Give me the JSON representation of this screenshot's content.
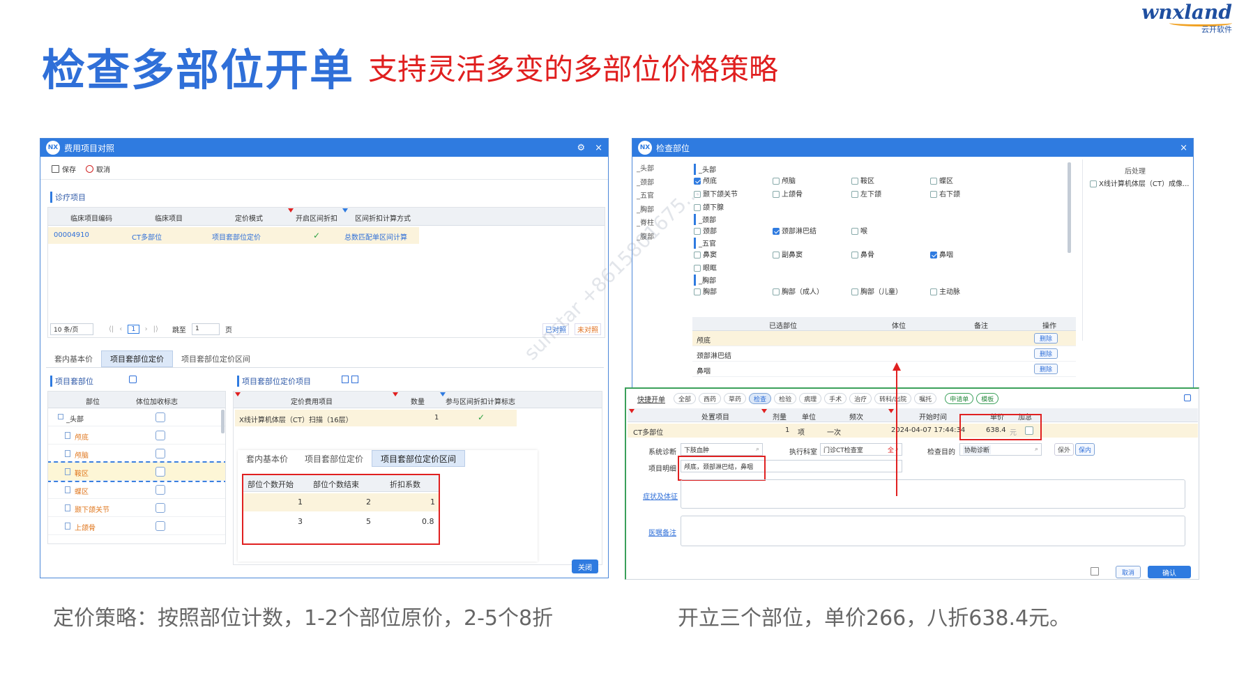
{
  "slide": {
    "title": "检查多部位开单",
    "subtitle": "支持灵活多变的多部位价格策略",
    "logo_text": "wnxland",
    "logo_sub": "云开软件",
    "caption_left": "定价策略：按照部位计数，1-2个部位原价，2-5个8折",
    "caption_right": "开立三个部位，单价266，八折638.4元。",
    "watermark": "sunstar +8615801675..."
  },
  "left": {
    "title": "费用项目对照",
    "gear": "⚙",
    "close": "×",
    "toolbar": {
      "save": "保存",
      "cancel": "取消"
    },
    "section": "诊疗项目",
    "cols": [
      "临床项目编码",
      "临床项目",
      "定价模式",
      "开启区间折扣",
      "区间折扣计算方式"
    ],
    "row": {
      "code": "00004910",
      "item": "CT多部位",
      "mode": "项目套部位定价",
      "flag": "✓",
      "calc": "总数匹配单区间计算"
    },
    "pager": {
      "size": "10 条/页",
      "first": "⟨|",
      "prev": "‹",
      "page": "1",
      "next": "›",
      "last": "|⟩",
      "jump": "跳至",
      "jump_val": "1",
      "unit": "页",
      "matched": "已对照",
      "unmatched": "未对照"
    },
    "tabs": [
      "套内基本价",
      "项目套部位定价",
      "项目套部位定价区间"
    ],
    "part_section": "项目套部位",
    "part_cols": [
      "部位",
      "体位加收标志"
    ],
    "parts": [
      "_头部",
      "颅底",
      "颅脑",
      "鞍区",
      "蝶区",
      "颞下颌关节",
      "上颌骨"
    ],
    "price_section": "项目套部位定价项目",
    "price_cols": [
      "定价费用项目",
      "数量",
      "参与区间折扣计算标志"
    ],
    "price_row": {
      "item": "X线计算机体层（CT）扫描（16层）",
      "qty": "1",
      "flag": "✓"
    },
    "subtabs": [
      "套内基本价",
      "项目套部位定价",
      "项目套部位定价区间"
    ],
    "range_cols": [
      "部位个数开始",
      "部位个数结束",
      "折扣系数"
    ],
    "ranges": [
      {
        "start": "1",
        "end": "2",
        "factor": "1"
      },
      {
        "start": "3",
        "end": "5",
        "factor": "0.8"
      }
    ],
    "close_btn": "关闭"
  },
  "right": {
    "title": "检查部位",
    "close": "×",
    "nav": [
      "_头部",
      "_颈部",
      "_五官",
      "_胸部",
      "_脊柱",
      "_腹部"
    ],
    "groups": [
      {
        "name": "_头部",
        "items": [
          {
            "t": "颅底",
            "on": true
          },
          {
            "t": "颅脑",
            "on": false
          },
          {
            "t": "鞍区",
            "on": false
          },
          {
            "t": "蝶区",
            "on": false
          },
          {
            "t": "颞下颌关节",
            "on": false
          },
          {
            "t": "上颌骨",
            "on": false
          },
          {
            "t": "左下颌",
            "on": false
          },
          {
            "t": "右下颌",
            "on": false
          },
          {
            "t": "颌下腺",
            "on": false
          }
        ]
      },
      {
        "name": "_颈部",
        "items": [
          {
            "t": "颈部",
            "on": false
          },
          {
            "t": "颈部淋巴结",
            "on": true
          },
          {
            "t": "喉",
            "on": false
          }
        ]
      },
      {
        "name": "_五官",
        "items": [
          {
            "t": "鼻窦",
            "on": false
          },
          {
            "t": "副鼻窦",
            "on": false
          },
          {
            "t": "鼻骨",
            "on": false
          },
          {
            "t": "鼻咽",
            "on": true
          },
          {
            "t": "眼眶",
            "on": false
          }
        ]
      },
      {
        "name": "_胸部",
        "items": [
          {
            "t": "胸部",
            "on": false
          },
          {
            "t": "胸部（成人）",
            "on": false
          },
          {
            "t": "胸部（儿童）",
            "on": false
          },
          {
            "t": "主动脉",
            "on": false
          }
        ]
      }
    ],
    "post_title": "后处理",
    "post_item": "X线计算机体层（CT）成像...",
    "sel_cols": [
      "已选部位",
      "体位",
      "备注",
      "操作"
    ],
    "selected": [
      "颅底",
      "颈部淋巴结",
      "鼻咽"
    ],
    "del": "删除"
  },
  "order": {
    "quick": "快捷开单",
    "chips": [
      "全部",
      "西药",
      "草药",
      "检查",
      "检验",
      "病理",
      "手术",
      "治疗",
      "转科/出院",
      "嘱托"
    ],
    "apply": "申请单",
    "tpl": "模板",
    "cols": [
      "处置项目",
      "剂量",
      "单位",
      "频次",
      "开始时间",
      "单价",
      "加急"
    ],
    "row": {
      "item": "CT多部位",
      "dose": "1",
      "unit": "项",
      "freq": "一次",
      "time": "2024-04-07 17:44:34",
      "price": "638.4",
      "cur": "元"
    },
    "diag_label": "系统诊断",
    "diag_val": "下肢血肿",
    "dept_label": "执行科室",
    "dept_val": "门诊CT检查室",
    "dept_mark": "全",
    "purpose_label": "检查目的",
    "purpose_val": "协助诊断",
    "out": "保外",
    "in": "保内",
    "detail_label": "项目明细",
    "detail_val": "颅底，颈部淋巴结，鼻咽",
    "symptom": "症状及体征",
    "remark": "医嘱备注",
    "cancel": "取消",
    "confirm": "确认"
  },
  "colors": {
    "accent": "#2f7be0",
    "title": "#2f6fd8",
    "subtitle": "#e01f1f",
    "highlight": "#e02020",
    "row": "#fbf3dc"
  }
}
